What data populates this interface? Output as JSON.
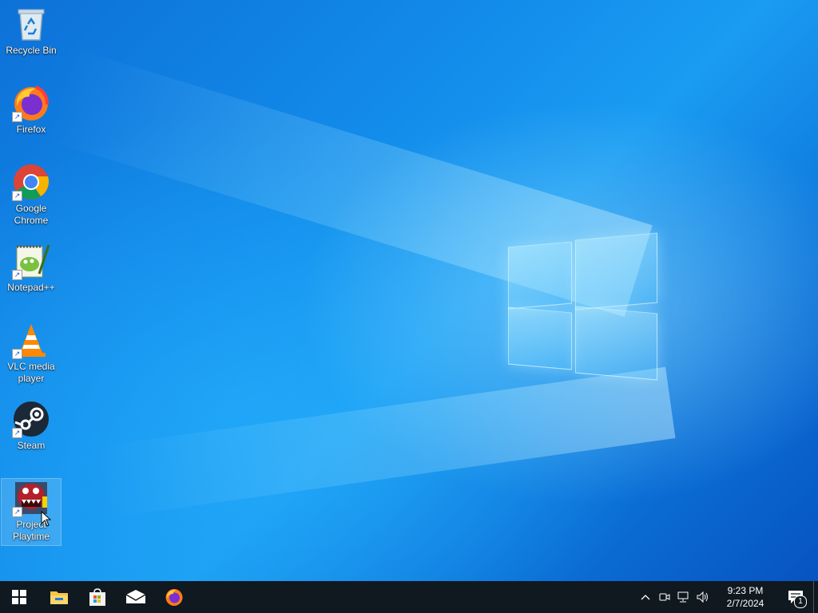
{
  "desktop": {
    "icons": [
      {
        "label": "Recycle Bin",
        "icon": "recycle-bin-icon"
      },
      {
        "label": "Firefox",
        "icon": "firefox-icon"
      },
      {
        "label": "Google\nChrome",
        "icon": "chrome-icon"
      },
      {
        "label": "Notepad++",
        "icon": "notepad-plus-plus-icon"
      },
      {
        "label": "VLC media\nplayer",
        "icon": "vlc-icon"
      },
      {
        "label": "Steam",
        "icon": "steam-icon"
      },
      {
        "label": "Project\nPlaytime",
        "icon": "project-playtime-icon"
      }
    ],
    "selected_icon": "Project\nPlaytime"
  },
  "taskbar": {
    "pinned": [
      "start-icon",
      "file-explorer-icon",
      "microsoft-store-icon",
      "mail-icon",
      "firefox-icon"
    ],
    "tray": {
      "icons": [
        "chevron-up-icon",
        "meet-now-icon",
        "network-icon",
        "volume-icon"
      ],
      "time": "9:23 PM",
      "date": "2/7/2024",
      "notification_count": "1"
    }
  },
  "colors": {
    "taskbar_bg": "#101820",
    "wallpaper_accent": "#128bea"
  }
}
